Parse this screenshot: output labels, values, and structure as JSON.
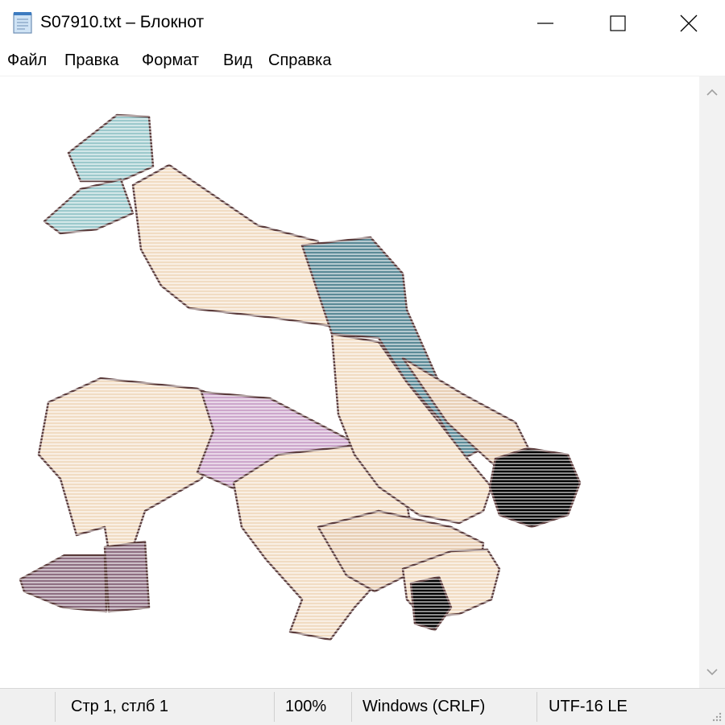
{
  "window": {
    "title": "S07910.txt – Блокнот",
    "icon": "notepad-icon",
    "controls": [
      "minimize-icon",
      "maximize-icon",
      "close-icon"
    ]
  },
  "menu": {
    "items": [
      "Файл",
      "Правка",
      "Формат",
      "Вид",
      "Справка"
    ]
  },
  "content": {
    "image": "ascii-art-wrestlers"
  },
  "status": {
    "position": "Стр 1, стлб 1",
    "zoom": "100%",
    "line_endings": "Windows (CRLF)",
    "encoding": "UTF-16 LE"
  },
  "colors": {
    "skin": "#f1dcc3",
    "skin_shadow": "#d8b89a",
    "wrestler_top_suit": "#5b8a97",
    "wrestler_bottom_suit": "#cda7cc",
    "socks": "#9cc9cc",
    "boots": "#8e6f82",
    "hair": "#000000",
    "outline": "#5a3a3a"
  }
}
